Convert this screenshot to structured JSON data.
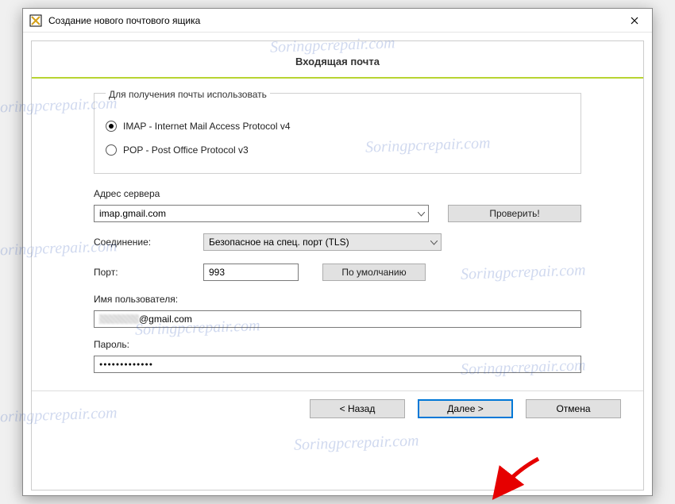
{
  "window": {
    "title": "Создание нового почтового ящика"
  },
  "heading": "Входящая почта",
  "protocol": {
    "legend": "Для получения почты использовать",
    "imap_label": "IMAP - Internet Mail Access Protocol v4",
    "pop_label": "POP  -  Post Office Protocol v3",
    "selected": "imap"
  },
  "server": {
    "label": "Адрес сервера",
    "value": "imap.gmail.com",
    "check_button": "Проверить!"
  },
  "connection": {
    "label": "Соединение:",
    "value": "Безопасное на спец. порт (TLS)"
  },
  "port": {
    "label": "Порт:",
    "value": "993",
    "default_button": "По умолчанию"
  },
  "username": {
    "label": "Имя пользователя:",
    "value_suffix": "@gmail.com"
  },
  "password": {
    "label": "Пароль:",
    "value_mask": "●●●●●●●●●●●●●"
  },
  "footer": {
    "back": "<  Назад",
    "next": "Далее  >",
    "cancel": "Отмена"
  },
  "watermark_text": "Soringpcrepair.com"
}
